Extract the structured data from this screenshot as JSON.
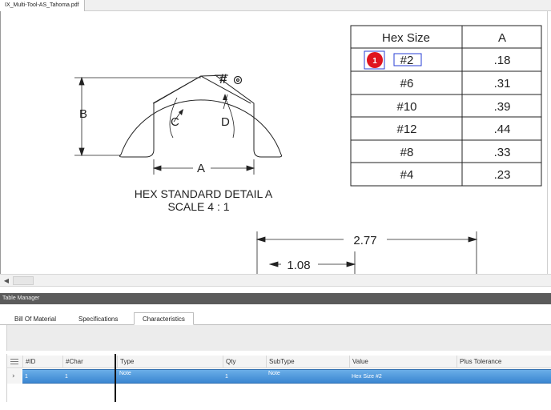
{
  "document_tab": {
    "label": "IX_Multi-Tool-AS_Tahoma.pdf"
  },
  "drawing": {
    "detail_title": "HEX STANDARD DETAIL A",
    "detail_scale": "SCALE 4 : 1",
    "dim_labels": {
      "a": "A",
      "b": "B",
      "c": "C",
      "d": "D"
    },
    "balloon_label": "#",
    "lower_dims": {
      "overall": "2.77",
      "partial": "1.08"
    },
    "hex_table": {
      "headers": [
        "Hex Size",
        "A"
      ],
      "rows": [
        {
          "size": "#2",
          "a": ".18"
        },
        {
          "size": "#6",
          "a": ".31"
        },
        {
          "size": "#10",
          "a": ".39"
        },
        {
          "size": "#12",
          "a": ".44"
        },
        {
          "size": "#8",
          "a": ".33"
        },
        {
          "size": "#4",
          "a": ".23"
        }
      ]
    },
    "marker": {
      "number": "1",
      "color": "#e0141e"
    }
  },
  "table_manager": {
    "title": "Table Manager",
    "tabs": [
      "Bill Of Material",
      "Specifications",
      "Characteristics"
    ],
    "active_tab": "Characteristics",
    "columns": [
      "#ID",
      "#Char",
      "Type",
      "Qty",
      "SubType",
      "Value",
      "Plus Tolerance"
    ],
    "rows": [
      {
        "id": "1",
        "char": "1",
        "type": "Note",
        "qty": "1",
        "subtype": "Note",
        "value": "Hex Size #2",
        "plus_tol": ""
      }
    ],
    "selected_row_color": "#3b86d1"
  }
}
